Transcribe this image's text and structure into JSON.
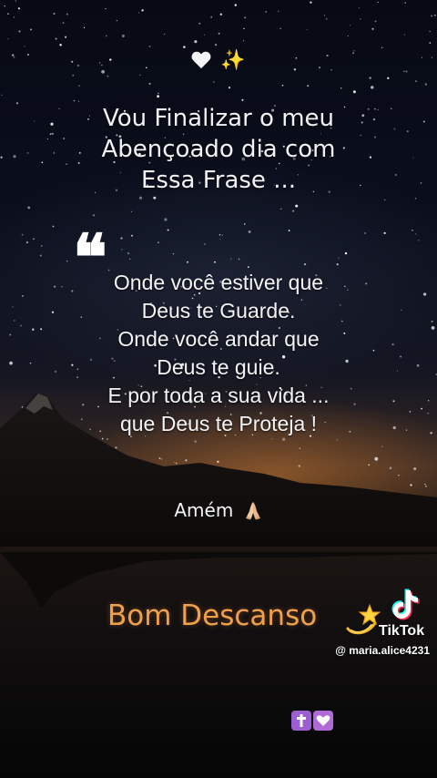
{
  "top_emojis": [
    "white-heart",
    "sparkles"
  ],
  "intro_lines": [
    "Vou Finalizar o meu",
    "Abençoado dia com",
    "Essa Frase ..."
  ],
  "quote_mark": "❝",
  "quote_lines": [
    "Onde você estiver que",
    "Deus te Guarde.",
    "Onde você andar que",
    "Deus te guie.",
    "E por toda a sua vida ...",
    "que Deus te Proteja !"
  ],
  "closing": "Amém",
  "closing_icon": "praying-hands-icon",
  "signoff": "Bom Descanso",
  "signoff_icon": "dizzy-star-icon",
  "watermark": {
    "brand": "TikTok",
    "handle": "@ maria.alice4231"
  },
  "bottom_emojis": [
    "latin-cross-icon",
    "white-heart-icon"
  ],
  "colors": {
    "signoff": "#f0a04a",
    "text": "#f4f4f6",
    "emoji_box": "#9b5fd1"
  }
}
